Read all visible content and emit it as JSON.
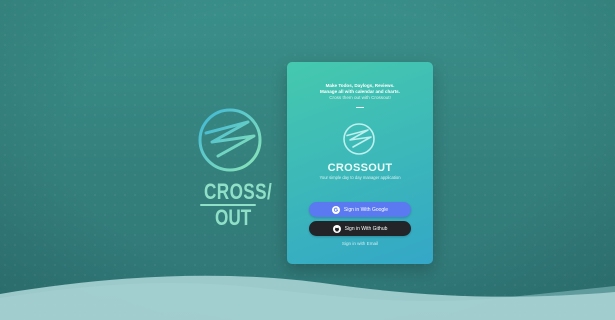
{
  "brand": {
    "word_top": "CROSS/",
    "word_bottom": "OUT"
  },
  "card": {
    "intro_line_1": "Make Todos, Daylogs, Reviews.",
    "intro_line_2": "Manage all with calendar and charts.",
    "intro_line_3": "Cross them out with Crossout!",
    "title": "CROSSOUT",
    "tagline": "Your simple day to day manager application",
    "google_button_label": "Sign in With Google",
    "github_button_label": "Sign in With Github",
    "email_link_label": "Sign in with Email"
  },
  "colors": {
    "background": "#347f7c",
    "card_gradient_start": "#45c9ae",
    "card_gradient_end": "#34a7c7",
    "google_button": "#5b79f0",
    "github_button": "#232427",
    "brand_accent": "#8fe0c7",
    "wave": "#a9d3d4"
  },
  "icons": {
    "brand_logo": "crossout-logo-icon",
    "google": "google-icon",
    "github": "github-icon"
  }
}
